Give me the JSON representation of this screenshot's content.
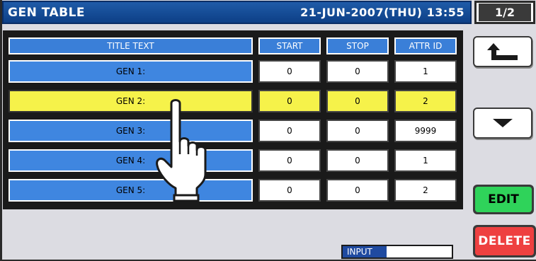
{
  "header": {
    "title": "GEN TABLE",
    "datetime": "21-JUN-2007(THU) 13:55",
    "page": "1/2"
  },
  "table": {
    "columns": [
      "TITLE TEXT",
      "START",
      "STOP",
      "ATTR ID"
    ],
    "rows": [
      {
        "title": "GEN 1:",
        "start": "0",
        "stop": "0",
        "attr": "1"
      },
      {
        "title": "GEN 2:",
        "start": "0",
        "stop": "0",
        "attr": "2"
      },
      {
        "title": "GEN 3:",
        "start": "0",
        "stop": "0",
        "attr": "9999"
      },
      {
        "title": "GEN 4:",
        "start": "0",
        "stop": "0",
        "attr": "1"
      },
      {
        "title": "GEN 5:",
        "start": "0",
        "stop": "0",
        "attr": "2"
      }
    ],
    "selected_row": 1
  },
  "buttons": {
    "back_icon": "return-arrow-icon",
    "down_icon": "down-triangle-icon",
    "edit": "EDIT",
    "delete": "DELETE"
  },
  "input": {
    "label": "INPUT",
    "value": ""
  },
  "colors": {
    "title_bar": "#0d3f86",
    "cell_blue": "#3f86e0",
    "selected": "#f6f24a",
    "edit": "#2fd35a",
    "delete": "#ee4040"
  }
}
